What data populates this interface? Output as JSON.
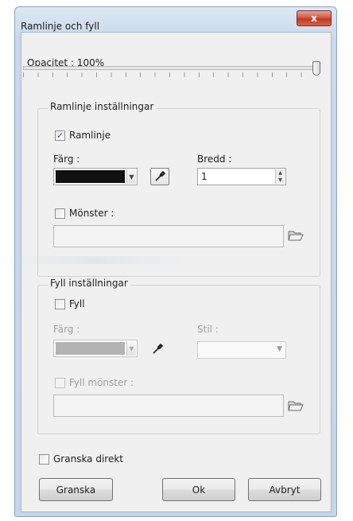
{
  "window": {
    "title": "Ramlinje och fyll",
    "close_glyph": "x",
    "colors": {
      "frame": "#c6d6ea",
      "close": "#c9432e",
      "client": "#f0f0f0"
    }
  },
  "opacity": {
    "label": "Opacitet : 100%",
    "value_percent": 100
  },
  "border_settings": {
    "title": "Ramlinje inställningar",
    "enabled_label": "Ramlinje",
    "enabled": true,
    "color_label": "Färg :",
    "color": "#111111",
    "color_picker_icon": "eyedropper-icon",
    "width_label": "Bredd :",
    "width_value": "1",
    "pattern_label": "Mönster :",
    "pattern_enabled": false,
    "pattern_value": "",
    "pattern_browse_icon": "open-folder-icon"
  },
  "fill_settings": {
    "title": "Fyll inställningar",
    "enabled_label": "Fyll",
    "enabled": false,
    "color_label": "Färg :",
    "color": "#b3b3b3",
    "color_picker_icon": "eyedropper-icon",
    "style_label": "Stil :",
    "style_value": "",
    "pattern_label": "Fyll mönster :",
    "pattern_enabled": false,
    "pattern_value": "",
    "pattern_browse_icon": "open-folder-icon"
  },
  "preview_direct": {
    "label": "Granska direkt",
    "checked": false
  },
  "buttons": {
    "preview": "Granska",
    "ok": "Ok",
    "cancel": "Avbryt"
  }
}
